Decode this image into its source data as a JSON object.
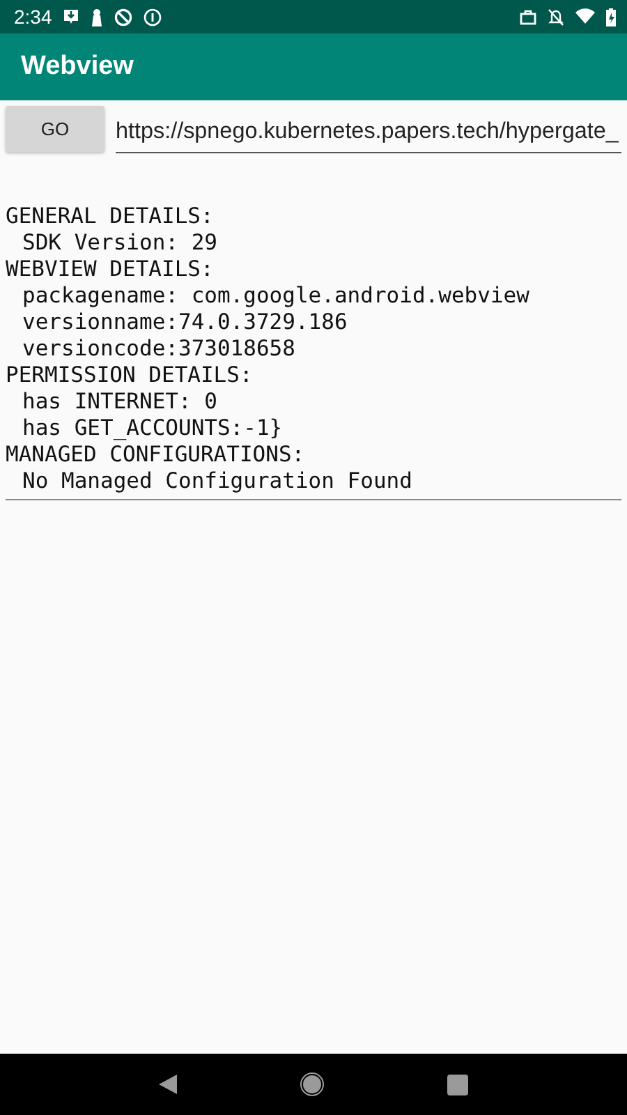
{
  "status_bar": {
    "time": "2:34"
  },
  "app_bar": {
    "title": "Webview"
  },
  "url_bar": {
    "button": "GO",
    "value": "https://spnego.kubernetes.papers.tech/hypergate_"
  },
  "details": [
    {
      "kind": "heading",
      "text": "GENERAL DETAILS:"
    },
    {
      "kind": "item",
      "text": "SDK Version: 29"
    },
    {
      "kind": "heading",
      "text": "WEBVIEW DETAILS:"
    },
    {
      "kind": "item",
      "text": "packagename: com.google.android.webview"
    },
    {
      "kind": "item",
      "text": "versionname:74.0.3729.186"
    },
    {
      "kind": "item",
      "text": "versioncode:373018658"
    },
    {
      "kind": "heading",
      "text": "PERMISSION DETAILS:"
    },
    {
      "kind": "item",
      "text": "has INTERNET: 0"
    },
    {
      "kind": "item",
      "text": "has GET_ACCOUNTS:-1}"
    },
    {
      "kind": "heading",
      "text": "MANAGED CONFIGURATIONS:"
    },
    {
      "kind": "item",
      "text": "No Managed Configuration Found"
    }
  ]
}
